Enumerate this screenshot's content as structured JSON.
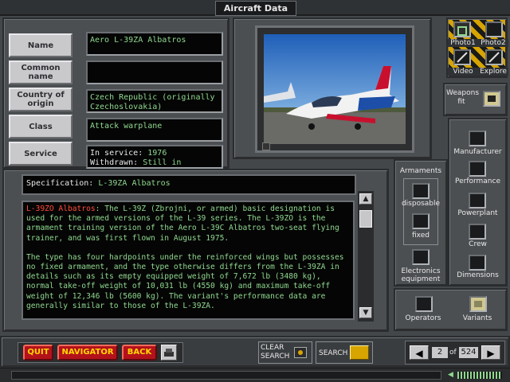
{
  "window": {
    "title": "Aircraft Data"
  },
  "labels": {
    "name": "Name",
    "common_name": "Common name",
    "country": "Country of origin",
    "class": "Class",
    "service": "Service"
  },
  "fields": {
    "name": "Aero L-39ZA Albatros",
    "common_name": "",
    "country_1": "Czech Republic (originally",
    "country_2": "Czechoslovakia)",
    "class": "Attack warplane",
    "in_service_label": "In service:",
    "in_service_value": "1976",
    "withdrawn_label": "Withdrawn:",
    "withdrawn_value": "Still in service"
  },
  "specification": {
    "label": "Specification:",
    "value": "L-39ZA Albatros"
  },
  "description": {
    "highlight": "L-39ZO Albatros",
    "para1": ": The L-39Z (Zbrojni, or armed) basic designation is used for the armed versions of the L-39 series. The L-39ZO is the armament training version of the Aero L-39C Albatros two-seat flying trainer, and was first flown in August 1975.",
    "para2": "The type has four hardpoints under the reinforced wings but possesses no fixed armament, and the type otherwise differs from the L-39ZA in details such as its empty equipped weight of 7,672 lb (3480 kg), normal take-off weight of 10,031 lb (4550 kg) and maximum take-off weight of 12,346 lb (5600 kg). The variant's performance data are generally similar to those of the L-39ZA."
  },
  "media": {
    "photo1": "Photo1",
    "photo2": "Photo2",
    "video": "Video",
    "explore": "Explore",
    "weapons_fit_1": "Weapons",
    "weapons_fit_2": "fit"
  },
  "armaments": {
    "title": "Armaments",
    "disposable": "disposable",
    "fixed": "fixed",
    "electronics_1": "Electronics",
    "electronics_2": "equipment"
  },
  "categories": {
    "manufacturer": "Manufacturer",
    "performance": "Performance",
    "powerplant": "Powerplant",
    "crew": "Crew",
    "dimensions": "Dimensions"
  },
  "bottom_right": {
    "operators": "Operators",
    "variants": "Variants"
  },
  "toolbar": {
    "quit": "QUIT",
    "navigator": "NAVIGATOR",
    "back": "BACK",
    "clear_search_1": "CLEAR",
    "clear_search_2": "SEARCH",
    "search": "SEARCH"
  },
  "pager": {
    "current": "2",
    "of": "of",
    "total": "524"
  },
  "colors": {
    "accent_red": "#b3121b",
    "text_green": "#8fd88f",
    "highlight_red": "#ff4a3a",
    "hazard_yellow": "#d7a400"
  }
}
